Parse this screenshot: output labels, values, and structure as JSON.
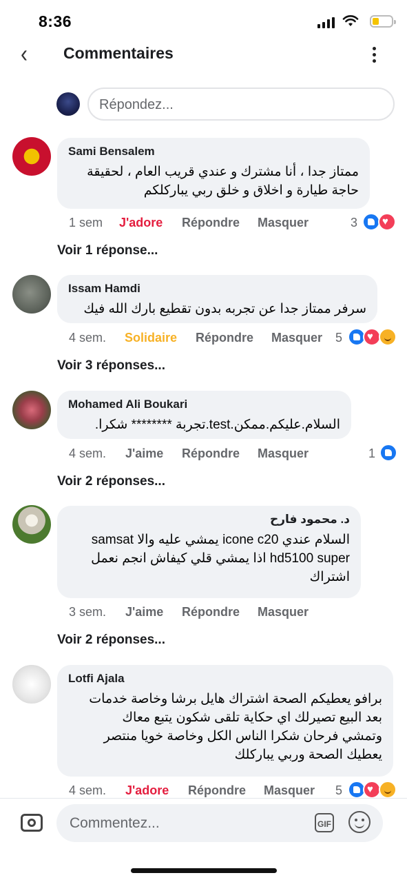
{
  "status_bar": {
    "time": "8:36"
  },
  "header": {
    "title": "Commentaires"
  },
  "reply_box": {
    "placeholder": "Répondez..."
  },
  "comments": [
    {
      "author": "Sami Bensalem",
      "lines": [
        "ممتاز جدا ، أنا مشترك و عندي قريب العام ، لحقيقة",
        "حاجة طيارة و اخلاق و خلق ربي يباركلكم"
      ],
      "time": "1 sem",
      "reaction_label": "J'adore",
      "reply": "Répondre",
      "hide": "Masquer",
      "count": "3",
      "view_replies": "Voir 1 réponse..."
    },
    {
      "author": "Issam Hamdi",
      "lines": [
        "سرفر ممتاز جدا عن تجربه بدون تقطيع بارك الله فيك"
      ],
      "time": "4 sem.",
      "reaction_label": "Solidaire",
      "reply": "Répondre",
      "hide": "Masquer",
      "count": "5",
      "view_replies": "Voir 3 réponses..."
    },
    {
      "author": "Mohamed Ali Boukari",
      "lines": [
        "السلام.عليكم.ممكن.test.تجربة ******** شكرا."
      ],
      "time": "4 sem.",
      "reaction_label": "J'aime",
      "reply": "Répondre",
      "hide": "Masquer",
      "count": "1",
      "view_replies": "Voir 2 réponses..."
    },
    {
      "author": "د. محمود فارح",
      "lines": [
        "السلام عندي icone c20 يمشي عليه والا samsat",
        "hd5100 super اذا يمشي قلي كيفاش انجم نعمل",
        "اشتراك"
      ],
      "time": "3 sem.",
      "reaction_label": "J'aime",
      "reply": "Répondre",
      "hide": "Masquer",
      "view_replies": "Voir 2 réponses..."
    },
    {
      "author": "Lotfi Ajala",
      "lines": [
        "برافو يعطيكم الصحة اشتراك هايل برشا وخاصة خدمات",
        "بعد البيع تصيرلك اي حكاية تلقى شكون يتبع معاك",
        "وتمشي فرحان شكرا الناس الكل وخاصة خويا منتصر",
        "يعطيك الصحة وربي يباركلك"
      ],
      "time": "4 sem.",
      "reaction_label": "J'adore",
      "reply": "Répondre",
      "hide": "Masquer",
      "count": "5"
    }
  ],
  "composer": {
    "placeholder": "Commentez...",
    "gif_label": "GIF"
  },
  "colors": {
    "like": "#1877f2",
    "love": "#f33e58",
    "care": "#f7b125",
    "bubble": "#f0f2f5",
    "meta": "#65676b"
  }
}
